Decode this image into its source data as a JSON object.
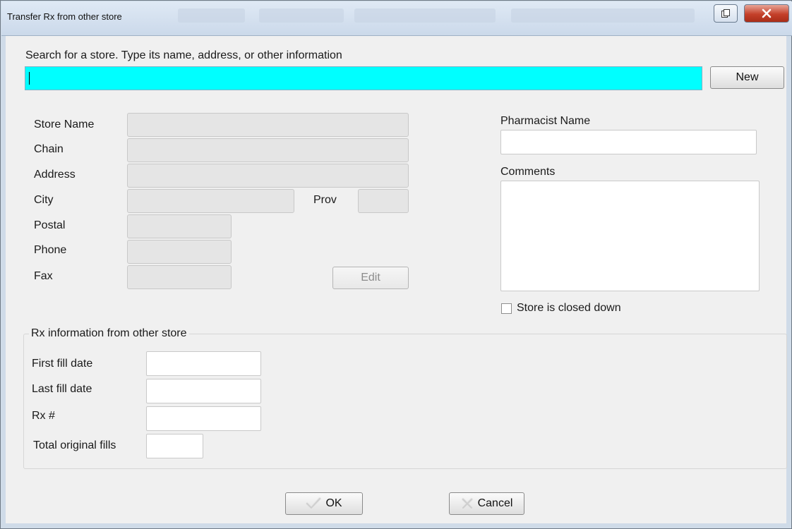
{
  "window": {
    "title": "Transfer Rx from other store"
  },
  "search": {
    "label": "Search for a store.  Type its name, address, or other information",
    "value": "",
    "new_button": "New"
  },
  "store": {
    "name_label": "Store Name",
    "chain_label": "Chain",
    "address_label": "Address",
    "city_label": "City",
    "prov_label": "Prov",
    "postal_label": "Postal",
    "phone_label": "Phone",
    "fax_label": "Fax",
    "edit_button": "Edit"
  },
  "pharmacist": {
    "label": "Pharmacist Name",
    "value": ""
  },
  "comments": {
    "label": "Comments",
    "value": ""
  },
  "closed": {
    "label": "Store is closed down",
    "checked": false
  },
  "rx_info": {
    "group_label": "Rx information from other store",
    "first_fill_label": "First fill date",
    "last_fill_label": "Last fill date",
    "rx_number_label": "Rx #",
    "total_fills_label": "Total original fills"
  },
  "footer": {
    "ok_label": "OK",
    "cancel_label": "Cancel"
  },
  "colors": {
    "search_bg": "#00ffff",
    "titlebar": "#cbd9ea",
    "close_button": "#c4402a"
  },
  "icons": {
    "restore": "restore-icon",
    "close": "close-icon",
    "ok": "checkmark-icon",
    "cancel": "cancel-x-icon"
  }
}
